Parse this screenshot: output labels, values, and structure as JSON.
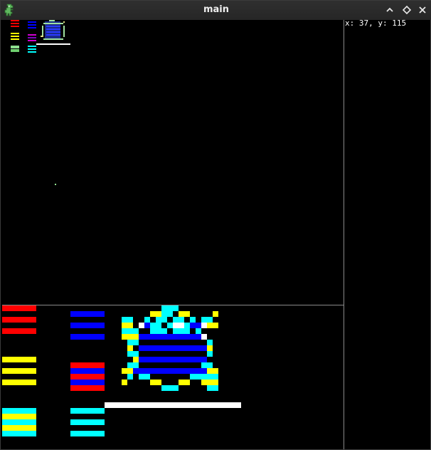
{
  "window": {
    "title": "main",
    "app_icon": "dinosaur-app-icon",
    "controls": {
      "minimize_icon": "chevron-up-icon",
      "maximize_icon": "diamond-maximize-icon",
      "close_icon": "close-icon"
    }
  },
  "status": {
    "coords_text": "x: 37, y: 115"
  },
  "palette": {
    "red": "#ff0000",
    "blue": "#0000ff",
    "yellow": "#ffff00",
    "cyan": "#00ffff",
    "white": "#ffffff",
    "magenta": "#b000b0",
    "green": "#8fe08f",
    "divider": "#8a8a8a",
    "background": "#000000"
  },
  "preview": {
    "label": "sprite-preview-thumbnail",
    "cursor_dot_color": "#8fe08f"
  },
  "editor": {
    "label": "sprite-zoom-editor"
  }
}
